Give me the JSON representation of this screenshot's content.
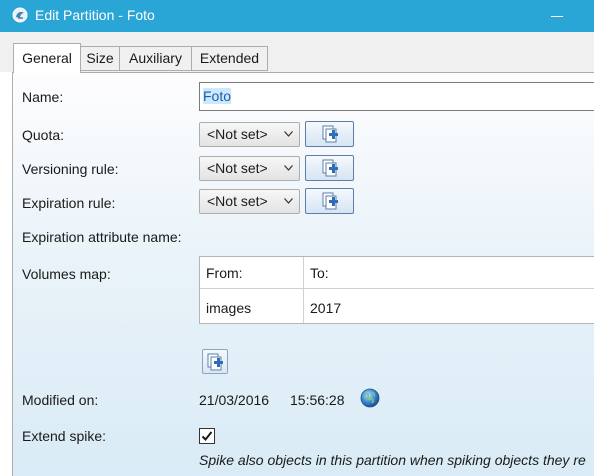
{
  "window": {
    "title": "Edit Partition - Foto"
  },
  "tabs": [
    {
      "label": "General",
      "active": true
    },
    {
      "label": "Size",
      "active": false
    },
    {
      "label": "Auxiliary",
      "active": false
    },
    {
      "label": "Extended",
      "active": false
    }
  ],
  "form": {
    "name_label": "Name:",
    "name_value": "Foto",
    "quota_label": "Quota:",
    "quota_value": "<Not set>",
    "versioning_label": "Versioning rule:",
    "versioning_value": "<Not set>",
    "expiration_label": "Expiration rule:",
    "expiration_value": "<Not set>",
    "expiration_attr_label": "Expiration attribute name:",
    "volumes_label": "Volumes map:",
    "volumes": {
      "columns": [
        "From:",
        "To:"
      ],
      "rows": [
        [
          "images",
          "2017"
        ]
      ]
    },
    "modified_label": "Modified on:",
    "modified_date": "21/03/2016",
    "modified_time": "15:56:28",
    "extend_spike_label": "Extend spike:",
    "extend_spike_checked": true,
    "extend_spike_hint_line1": "Spike also objects in this partition when spiking objects they re",
    "extend_spike_hint_line2": "... ... ... ... ... ..."
  },
  "icons": {
    "app": "partition-app-icon",
    "add": "add-new-icon",
    "globe": "globe-icon",
    "check": "checkmark-icon"
  },
  "colors": {
    "titlebar": "#2aa6d6",
    "selection": "#cce8ff",
    "button_border": "#5f7ea5"
  }
}
